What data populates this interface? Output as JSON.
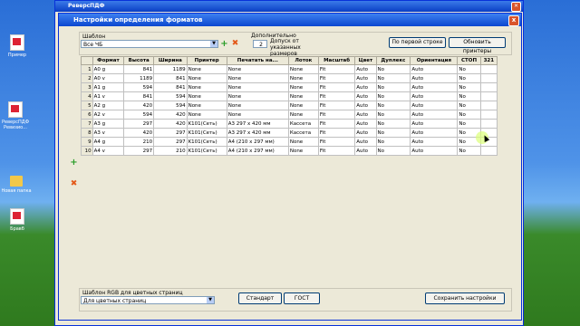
{
  "desktop": {
    "icons": [
      {
        "label": "Пример",
        "kind": "pdf"
      },
      {
        "label": "РеверсПДФ Ревизио...",
        "kind": "pdf"
      },
      {
        "label": "Новая папка",
        "kind": "folder"
      },
      {
        "label": "Бравб",
        "kind": "pdf"
      }
    ]
  },
  "main_window": {
    "title": "РеверсПДФ"
  },
  "dialog": {
    "title": "Настройки определения форматов",
    "close": "x",
    "template": {
      "label": "Шаблон",
      "value": "Все ЧБ"
    },
    "additional": {
      "label": "Дополнительно",
      "value": "2",
      "caption": "Допуск от указанных размеров"
    },
    "btn_first_row": "По первой строке",
    "btn_update_printers": "Обновить принтеры",
    "table": {
      "headers": [
        "",
        "Формат",
        "Высота",
        "Ширина",
        "Принтер",
        "Печатать на...",
        "Лоток",
        "Масштаб",
        "Цвет",
        "Дуплекс",
        "Ориентация",
        "СТОП",
        "321"
      ],
      "rows": [
        [
          "1",
          "A0 g",
          "841",
          "1189",
          "None",
          "None",
          "None",
          "Fit",
          "Auto",
          "No",
          "Auto",
          "No",
          ""
        ],
        [
          "2",
          "A0 v",
          "1189",
          "841",
          "None",
          "None",
          "None",
          "Fit",
          "Auto",
          "No",
          "Auto",
          "No",
          ""
        ],
        [
          "3",
          "A1 g",
          "594",
          "841",
          "None",
          "None",
          "None",
          "Fit",
          "Auto",
          "No",
          "Auto",
          "No",
          ""
        ],
        [
          "4",
          "A1 v",
          "841",
          "594",
          "None",
          "None",
          "None",
          "Fit",
          "Auto",
          "No",
          "Auto",
          "No",
          ""
        ],
        [
          "5",
          "A2 g",
          "420",
          "594",
          "None",
          "None",
          "None",
          "Fit",
          "Auto",
          "No",
          "Auto",
          "No",
          ""
        ],
        [
          "6",
          "A2 v",
          "594",
          "420",
          "None",
          "None",
          "None",
          "Fit",
          "Auto",
          "No",
          "Auto",
          "No",
          ""
        ],
        [
          "7",
          "A3 g",
          "297",
          "420",
          "K101(Сеть)",
          "A3 297 x 420 мм",
          "Кассета",
          "Fit",
          "Auto",
          "No",
          "Auto",
          "No",
          ""
        ],
        [
          "8",
          "A3 v",
          "420",
          "297",
          "K101(Сеть)",
          "A3 297 x 420 мм",
          "Кассета",
          "Fit",
          "Auto",
          "No",
          "Auto",
          "No",
          ""
        ],
        [
          "9",
          "A4 g",
          "210",
          "297",
          "K101(Сеть)",
          "A4 (210 x 297 мм)",
          "None",
          "Fit",
          "Auto",
          "No",
          "Auto",
          "No",
          ""
        ],
        [
          "10",
          "A4 v",
          "297",
          "210",
          "K101(Сеть)",
          "A4 (210 x 297 мм)",
          "None",
          "Fit",
          "Auto",
          "No",
          "Auto",
          "No",
          ""
        ]
      ]
    },
    "rgb": {
      "label": "Шаблон RGB для цветных страниц",
      "value": "Для цветных страниц"
    },
    "btn_standard": "Стандарт",
    "btn_gost": "ГОСТ",
    "btn_save": "Сохранить настройки"
  }
}
